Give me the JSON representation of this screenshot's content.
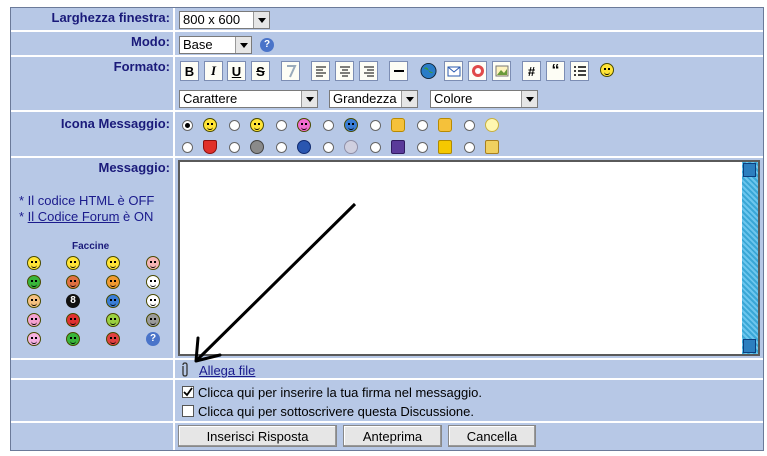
{
  "labels": {
    "window_width": "Larghezza finestra:",
    "mode": "Modo:",
    "format": "Formato:",
    "message_icon": "Icona Messaggio:",
    "message": "Messaggio:"
  },
  "window_width": {
    "value": "800 x 600"
  },
  "mode": {
    "value": "Base",
    "help": "?"
  },
  "format": {
    "bold": "B",
    "italic": "I",
    "underline": "U",
    "strike": "S",
    "hash": "#",
    "quote": "“",
    "font": "Carattere",
    "size": "Grandezza",
    "color": "Colore"
  },
  "info": {
    "html_prefix": "* Il codice HTML è OFF",
    "forum_star": "* ",
    "forum_link": "Il Codice Forum",
    "forum_suffix": " è ON",
    "faces_title": "Faccine",
    "faces_help": "?"
  },
  "attach": {
    "label": "Allega file"
  },
  "options": {
    "signature": "Clicca qui per inserire la tua firma nel messaggio.",
    "subscribe": "Clicca qui per sottoscrivere questa Discussione."
  },
  "buttons": {
    "submit": "Inserisci Risposta",
    "preview": "Anteprima",
    "cancel": "Cancella"
  },
  "colors": {
    "row_bg": "#b7c8e6",
    "label_text": "#1a1a7a",
    "scrollbar": "#3aa7d6"
  }
}
